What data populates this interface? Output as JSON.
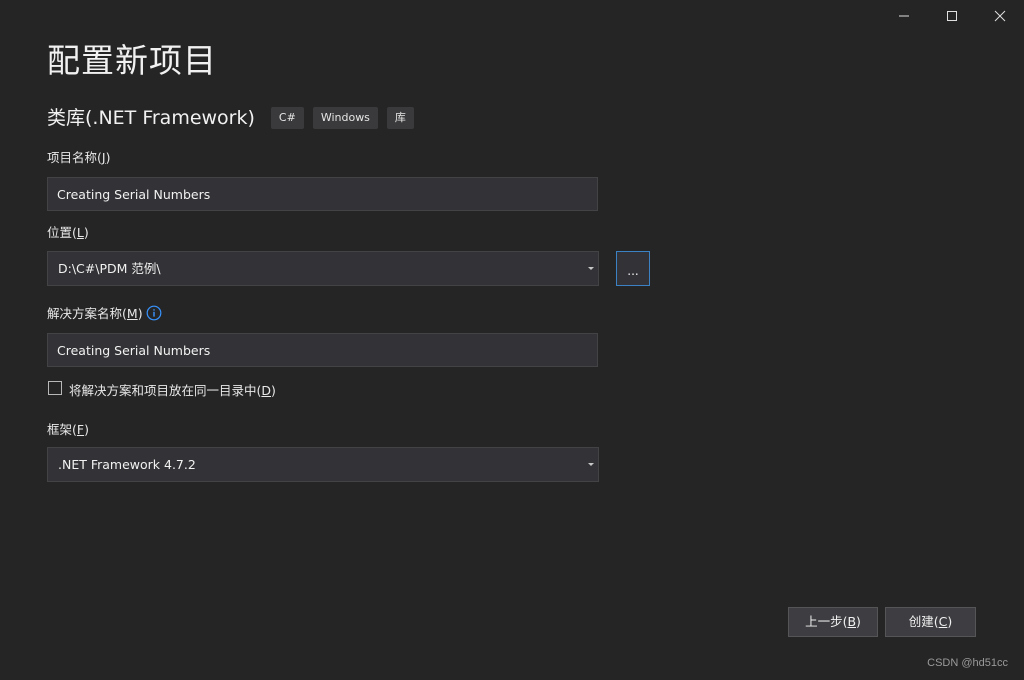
{
  "window": {
    "title": "配置新项目",
    "controls": {
      "minimize_icon": "minimize-icon",
      "maximize_icon": "maximize-icon",
      "close_icon": "close-icon"
    }
  },
  "template": {
    "name": "类库(.NET Framework)",
    "tags": [
      "C#",
      "Windows",
      "库"
    ]
  },
  "project_name": {
    "label_prefix": "项目名称(",
    "label_key": "J",
    "label_suffix": ")",
    "value": "Creating Serial Numbers"
  },
  "location": {
    "label_prefix": "位置(",
    "label_key": "L",
    "label_suffix": ")",
    "value": "D:\\C#\\PDM 范例\\",
    "browse_label": "..."
  },
  "solution_name": {
    "label_prefix": "解决方案名称(",
    "label_key": "M",
    "label_suffix": ")",
    "info_icon": "info-icon",
    "value": "Creating Serial Numbers"
  },
  "same_directory": {
    "checked": false,
    "label_prefix": "将解决方案和项目放在同一目录中(",
    "label_key": "D",
    "label_suffix": ")"
  },
  "framework": {
    "label_prefix": "框架(",
    "label_key": "F",
    "label_suffix": ")",
    "value": ".NET Framework 4.7.2"
  },
  "footer": {
    "back_prefix": "上一步(",
    "back_key": "B",
    "back_suffix": ")",
    "create_prefix": "创建(",
    "create_key": "C",
    "create_suffix": ")"
  },
  "watermark": "CSDN @hd51cc",
  "colors": {
    "background": "#252526",
    "input_bg": "#333337",
    "focus_border": "#3b82c4",
    "info_icon": "#3794ff"
  }
}
